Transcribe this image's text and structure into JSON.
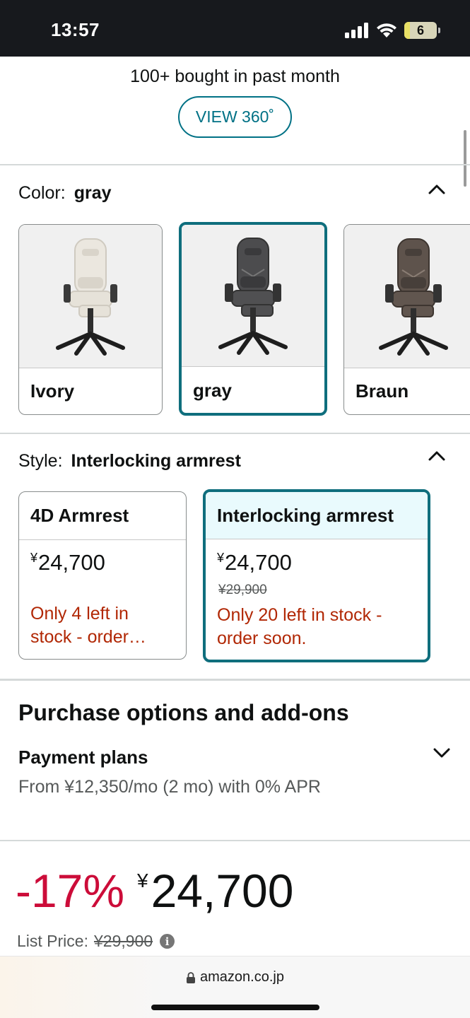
{
  "status_bar": {
    "time": "13:57",
    "battery_level": "6",
    "icons": [
      "signal-icon",
      "wifi-icon",
      "battery-icon"
    ]
  },
  "top": {
    "bought_text": "100+ bought in past month",
    "view360_label": "VIEW 360˚"
  },
  "color_section": {
    "label": "Color:",
    "selected_value": "gray",
    "options": [
      {
        "name": "Ivory",
        "selected": false,
        "chair_color": "#e9e6df"
      },
      {
        "name": "gray",
        "selected": true,
        "chair_color": "#4a4a4c"
      },
      {
        "name": "Braun",
        "selected": false,
        "chair_color": "#5b504a"
      }
    ]
  },
  "style_section": {
    "label": "Style:",
    "selected_value": "Interlocking armrest",
    "options": [
      {
        "name": "4D Armrest",
        "price": "24,700",
        "currency": "¥",
        "list_price": "",
        "stock": "Only 4 left in stock - order…",
        "selected": false
      },
      {
        "name": "Interlocking armrest",
        "price": "24,700",
        "currency": "¥",
        "list_price": "¥29,900",
        "stock": "Only 20 left in stock - order soon.",
        "selected": true
      }
    ]
  },
  "purchase_options": {
    "title": "Purchase options and add-ons",
    "payment_plans": {
      "title": "Payment plans",
      "description": "From ¥12,350/mo (2 mo) with 0% APR"
    }
  },
  "price": {
    "discount": "-17%",
    "currency": "¥",
    "amount": "24,700",
    "list_price_label": "List Price:",
    "list_price": "¥29,900"
  },
  "browser": {
    "url": "amazon.co.jp"
  },
  "colors": {
    "teal": "#007185",
    "selected_border": "#0f6e7d",
    "deal_red": "#cc0c39",
    "stock_red": "#b12704"
  }
}
